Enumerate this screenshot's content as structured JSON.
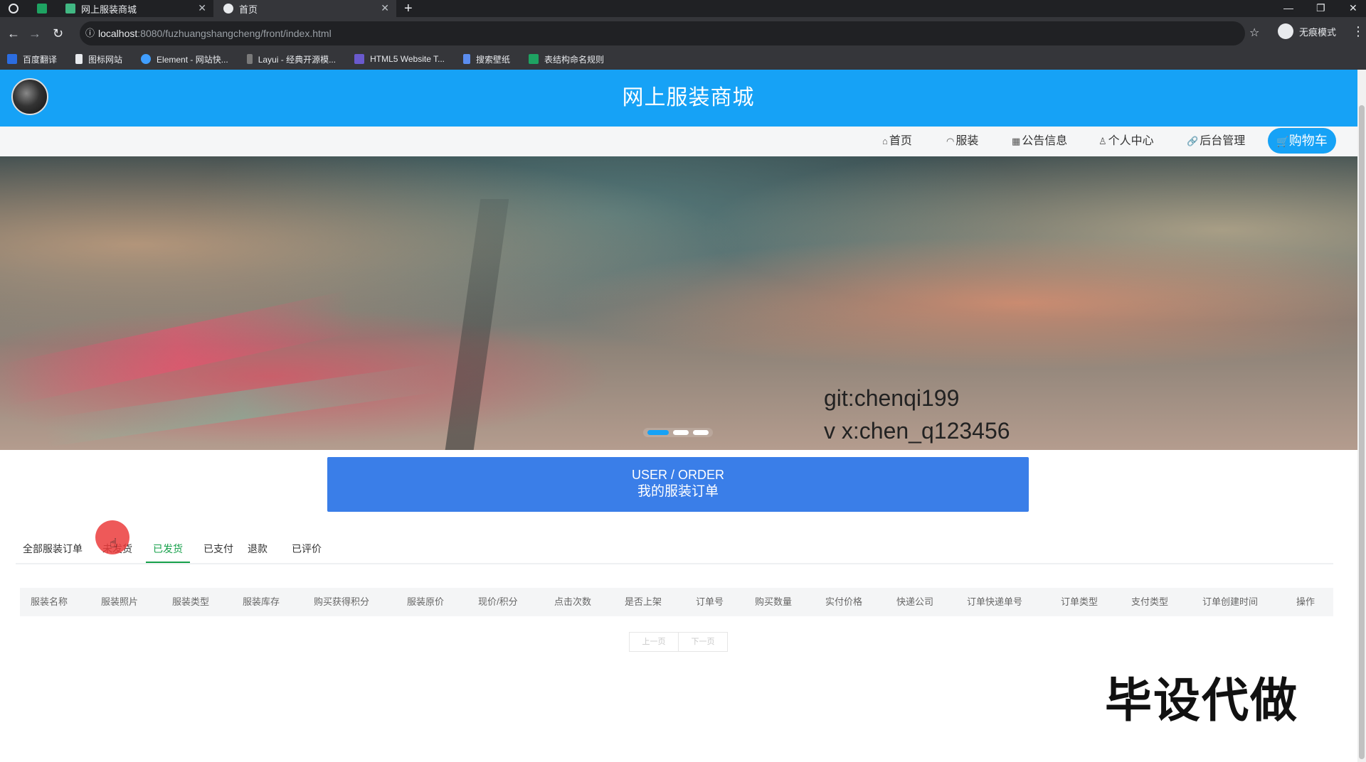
{
  "browser": {
    "tabs": [
      {
        "title": "网上服装商城"
      },
      {
        "title": "首页"
      }
    ],
    "new_tab": "+",
    "url_host": "localhost",
    "url_rest": ":8080/fuzhuangshangcheng/front/index.html",
    "profile_label": "无痕模式",
    "bookmarks": [
      "百度翻译",
      "图标网站",
      "Element - 网站快...",
      "Layui - 经典开源模...",
      "HTML5 Website T...",
      "搜索壁纸",
      "表结构命名规则"
    ]
  },
  "site": {
    "title": "网上服装商城",
    "nav": [
      "首页",
      "服装",
      "公告信息",
      "个人中心",
      "后台管理"
    ],
    "cart_label": "购物车"
  },
  "banner": {
    "overlay_line1": "git:chenqi199",
    "overlay_line2": "v x:chen_q123456",
    "slide_count": 3,
    "active_slide": 1
  },
  "order": {
    "heading_en": "USER / ORDER",
    "heading_cn": "我的服装订单",
    "tabs": [
      "全部服装订单",
      "未发货",
      "已发货",
      "已支付",
      "退款",
      "已评价"
    ],
    "active_tab": "已发货",
    "columns": [
      "服装名称",
      "服装照片",
      "服装类型",
      "服装库存",
      "购买获得积分",
      "服装原价",
      "现价/积分",
      "点击次数",
      "是否上架",
      "订单号",
      "购买数量",
      "实付价格",
      "快递公司",
      "订单快递单号",
      "订单类型",
      "支付类型",
      "订单创建时间",
      "操作"
    ],
    "pager": {
      "prev": "上一页",
      "next": "下一页"
    }
  },
  "watermark": "毕设代做",
  "colors": {
    "brand": "#16a2f6",
    "order_header": "#3a7ee8",
    "active_tab": "#16a04a"
  }
}
